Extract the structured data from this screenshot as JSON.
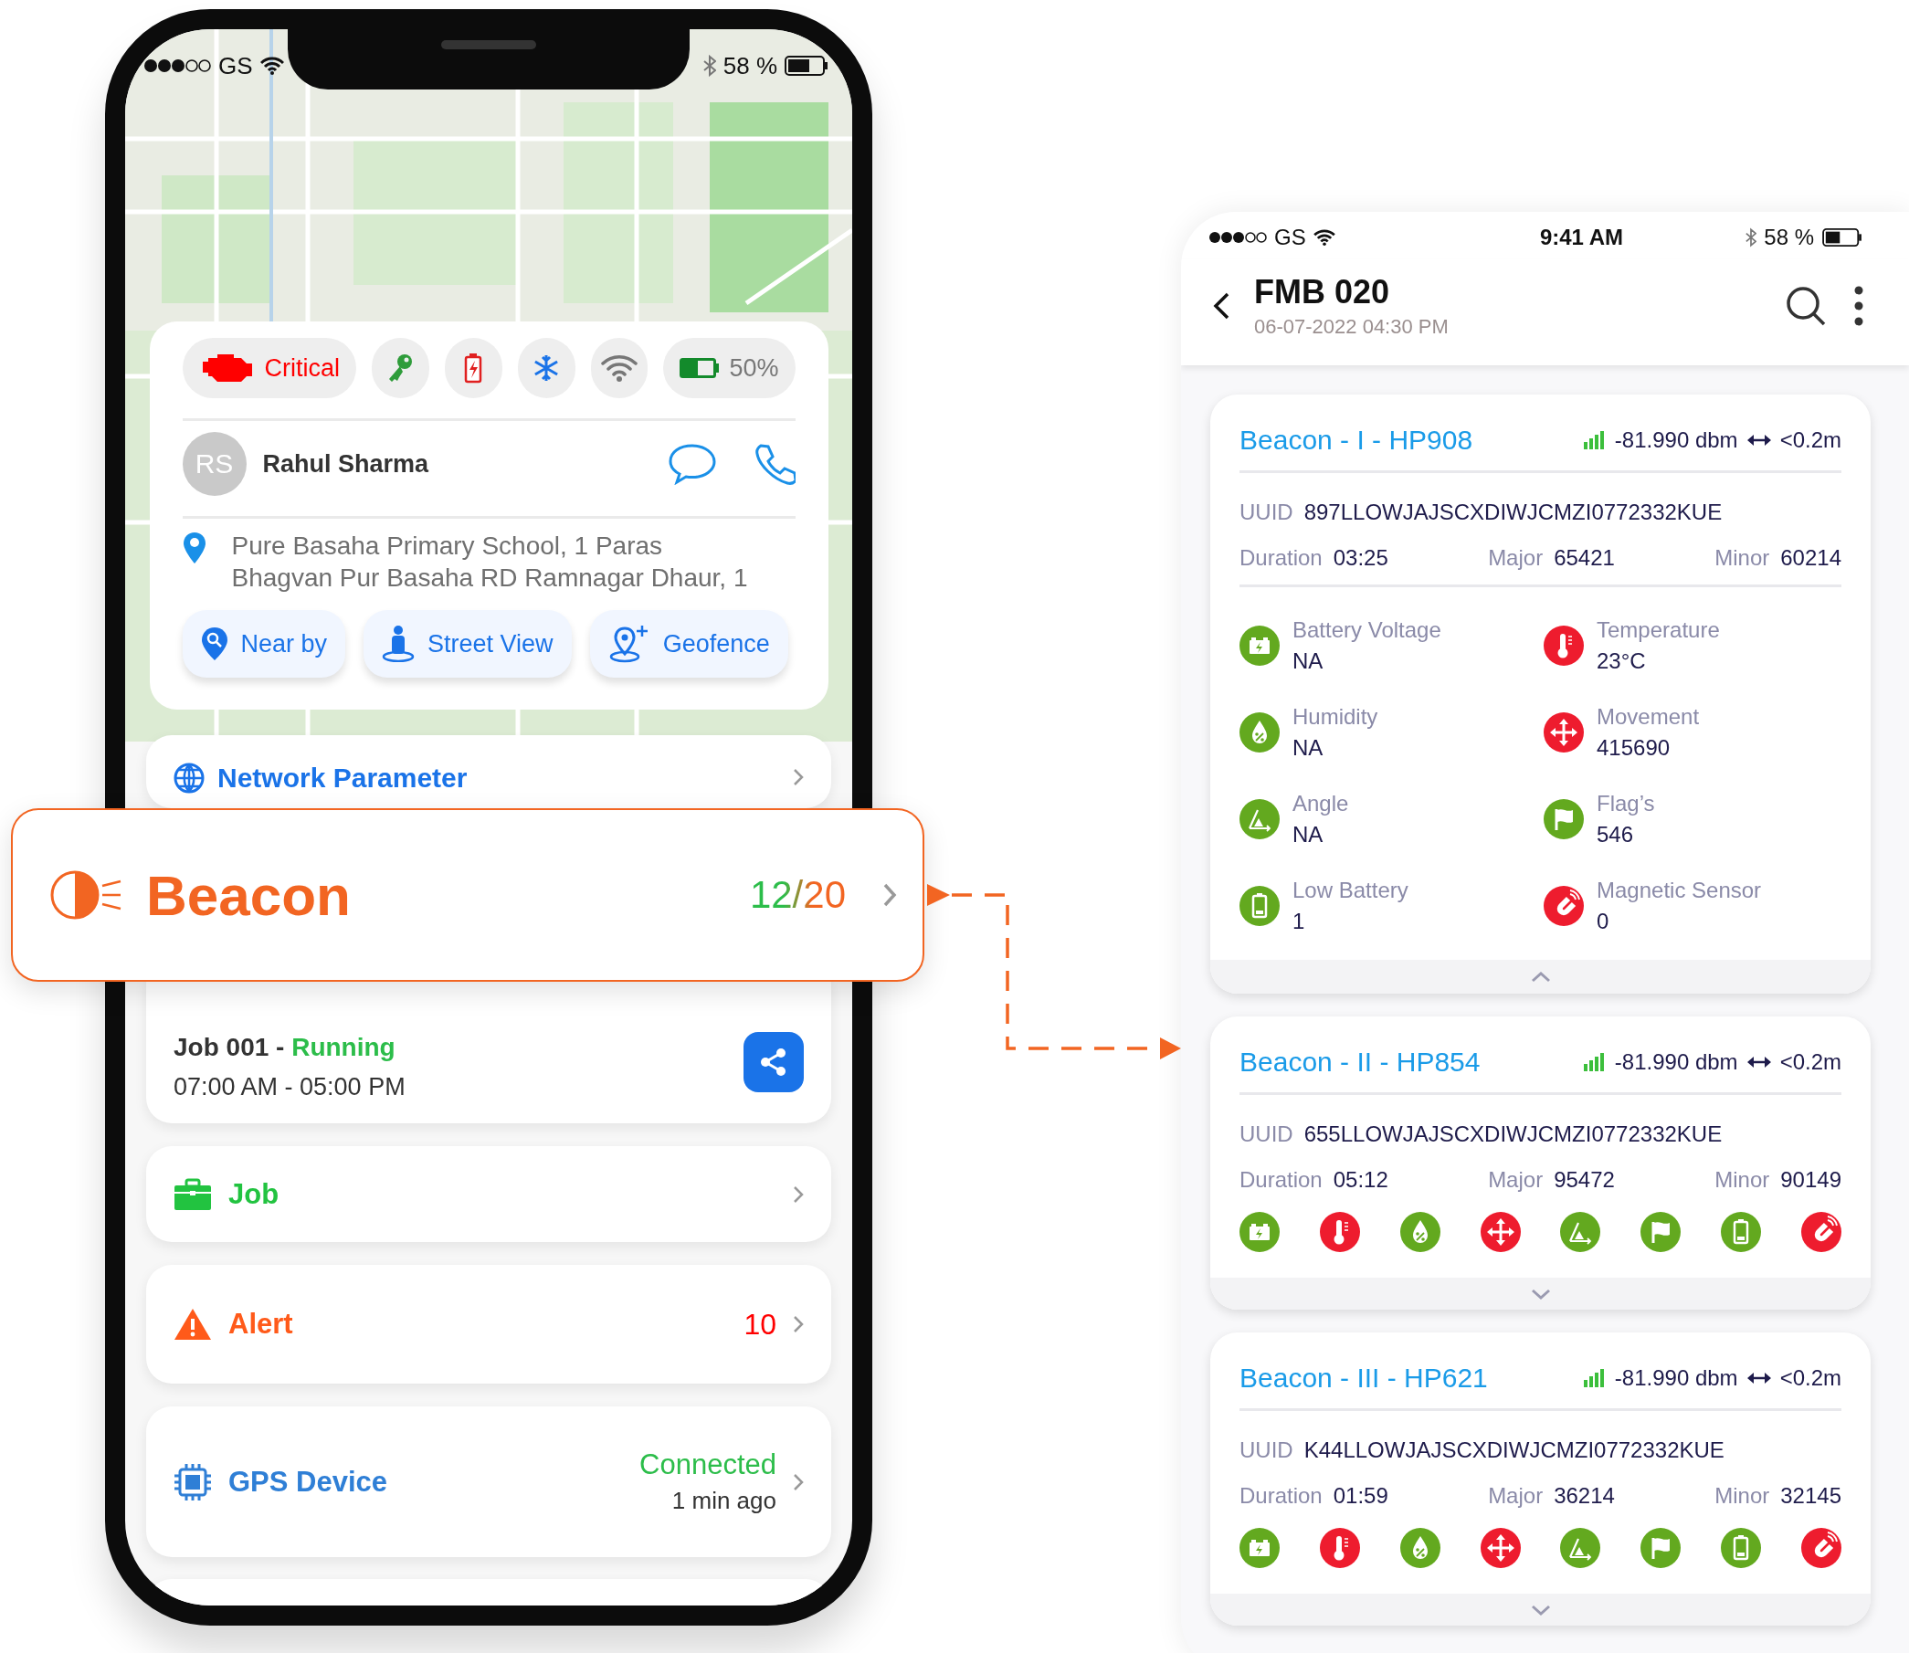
{
  "phone": {
    "status_bar": {
      "carrier": "GS",
      "battery": "58 %"
    },
    "status_chips": [
      {
        "kind": "engine",
        "label": "Critical"
      },
      {
        "kind": "key"
      },
      {
        "kind": "battery_alert"
      },
      {
        "kind": "snowflake"
      },
      {
        "kind": "wifi"
      },
      {
        "kind": "battery",
        "label": "50%"
      }
    ],
    "contact": {
      "initials": "RS",
      "name": "Rahul Sharma"
    },
    "address": "Pure Basaha Primary School, 1 Paras Bhagvan Pur Basaha RD Ramnagar Dhaur, 1",
    "actions": [
      {
        "kind": "nearby",
        "label": "Near by"
      },
      {
        "kind": "street_view",
        "label": "Street View"
      },
      {
        "kind": "geofence",
        "label": "Geofence"
      }
    ],
    "network": {
      "label": "Network Parameter"
    },
    "job_status": {
      "title": "Job 001 -",
      "status": "Running",
      "hours": "07:00 AM - 05:00 PM"
    },
    "menu": [
      {
        "kind": "job",
        "label": "Job"
      },
      {
        "kind": "alert",
        "label": "Alert",
        "count": "10"
      },
      {
        "kind": "gps",
        "label": "GPS Device",
        "status": "Connected",
        "time": "1 min ago"
      }
    ]
  },
  "callout": {
    "label": "Beacon",
    "count": "12/20"
  },
  "detail": {
    "status_bar": {
      "carrier": "GS",
      "time": "9:41 AM",
      "battery": "58 %"
    },
    "title": "FMB 020",
    "subtitle": "06-07-2022 04:30 PM",
    "beacons": [
      {
        "name": "Beacon - I - HP908",
        "signal": "-81.990 dbm",
        "range": "<0.2m",
        "uuid_label": "UUID",
        "uuid": "897LLOWJAJSCXDIWJCMZI0772332KUE",
        "duration_label": "Duration",
        "duration": "03:25",
        "major_label": "Major",
        "major": "65421",
        "minor_label": "Minor",
        "minor": "60214",
        "expanded": true,
        "sensors": [
          {
            "kind": "battery_voltage",
            "label": "Battery Voltage",
            "value": "NA"
          },
          {
            "kind": "temperature",
            "label": "Temperature",
            "value": "23°C"
          },
          {
            "kind": "humidity",
            "label": "Humidity",
            "value": "NA"
          },
          {
            "kind": "movement",
            "label": "Movement",
            "value": "415690"
          },
          {
            "kind": "angle",
            "label": "Angle",
            "value": "NA"
          },
          {
            "kind": "flags",
            "label": "Flag’s",
            "value": "546"
          },
          {
            "kind": "low_battery",
            "label": "Low Battery",
            "value": "1"
          },
          {
            "kind": "magnetic",
            "label": "Magnetic Sensor",
            "value": "0"
          }
        ]
      },
      {
        "name": "Beacon - II - HP854",
        "signal": "-81.990 dbm",
        "range": "<0.2m",
        "uuid_label": "UUID",
        "uuid": "655LLOWJAJSCXDIWJCMZI0772332KUE",
        "duration_label": "Duration",
        "duration": "05:12",
        "major_label": "Major",
        "major": "95472",
        "minor_label": "Minor",
        "minor": "90149",
        "expanded": false,
        "sensors": [
          {
            "kind": "battery_voltage"
          },
          {
            "kind": "temperature"
          },
          {
            "kind": "humidity"
          },
          {
            "kind": "movement"
          },
          {
            "kind": "angle"
          },
          {
            "kind": "flags"
          },
          {
            "kind": "low_battery"
          },
          {
            "kind": "magnetic"
          }
        ]
      },
      {
        "name": "Beacon - III - HP621",
        "signal": "-81.990 dbm",
        "range": "<0.2m",
        "uuid_label": "UUID",
        "uuid": "K44LLOWJAJSCXDIWJCMZI0772332KUE",
        "duration_label": "Duration",
        "duration": "01:59",
        "major_label": "Major",
        "major": "36214",
        "minor_label": "Minor",
        "minor": "32145",
        "expanded": false,
        "sensors": [
          {
            "kind": "battery_voltage"
          },
          {
            "kind": "temperature"
          },
          {
            "kind": "humidity"
          },
          {
            "kind": "movement"
          },
          {
            "kind": "angle"
          },
          {
            "kind": "flags"
          },
          {
            "kind": "low_battery"
          },
          {
            "kind": "magnetic"
          }
        ]
      }
    ]
  }
}
